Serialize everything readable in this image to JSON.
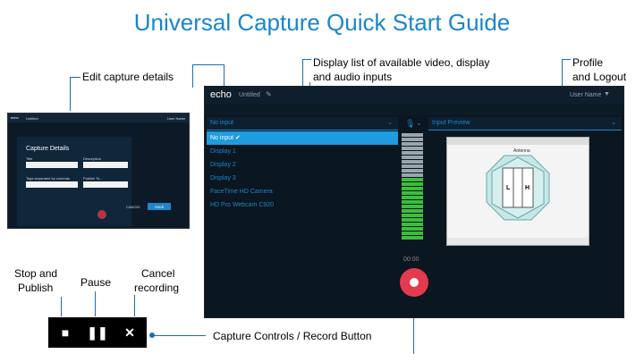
{
  "title": "Universal Capture Quick Start Guide",
  "annotations": {
    "edit_details": "Edit capture details",
    "inputs_line1": "Display list of available video, display",
    "inputs_line2": "and audio inputs",
    "profile_line1": "Profile",
    "profile_line2": "and Logout",
    "stop_line1": "Stop and",
    "stop_line2": "Publish",
    "pause": "Pause",
    "cancel_line1": "Cancel",
    "cancel_line2": "recording",
    "capture_controls": "Capture Controls / Record Button"
  },
  "app": {
    "logo": "echo",
    "capture_name": "Untitled",
    "user_menu": "User Name",
    "inputs_dropdown": "No input",
    "preview_label": "Input Preview",
    "timer": "00:00",
    "inputs": [
      {
        "label": "No input ✔",
        "selected": true
      },
      {
        "label": "Display 1",
        "selected": false
      },
      {
        "label": "Display 2",
        "selected": false
      },
      {
        "label": "Display 3",
        "selected": false
      },
      {
        "label": "FaceTime HD Camera",
        "selected": false
      },
      {
        "label": "HD Pro Webcam C920",
        "selected": false
      }
    ],
    "preview": {
      "slide_title": "Antenna",
      "letter_left": "L",
      "letter_right": "H"
    }
  },
  "mini": {
    "logo": "echo",
    "capture_name": "Untitled",
    "user_menu": "User Name",
    "panel_title": "Capture Details",
    "title_label": "Title",
    "description_label": "Description",
    "tags_label": "Tags separated by commas",
    "publish_label": "Publish To...",
    "cancel": "CANCEL",
    "save": "SAVE"
  },
  "controls": {
    "stop_icon": "stop-icon",
    "pause_icon": "pause-icon",
    "cancel_icon": "close-icon"
  },
  "colors": {
    "title": "#1a86c8",
    "accent": "#1f86c8",
    "record": "#e43a4d",
    "meter_green": "#3bbf3b",
    "meter_grey": "#9aa6ad"
  }
}
